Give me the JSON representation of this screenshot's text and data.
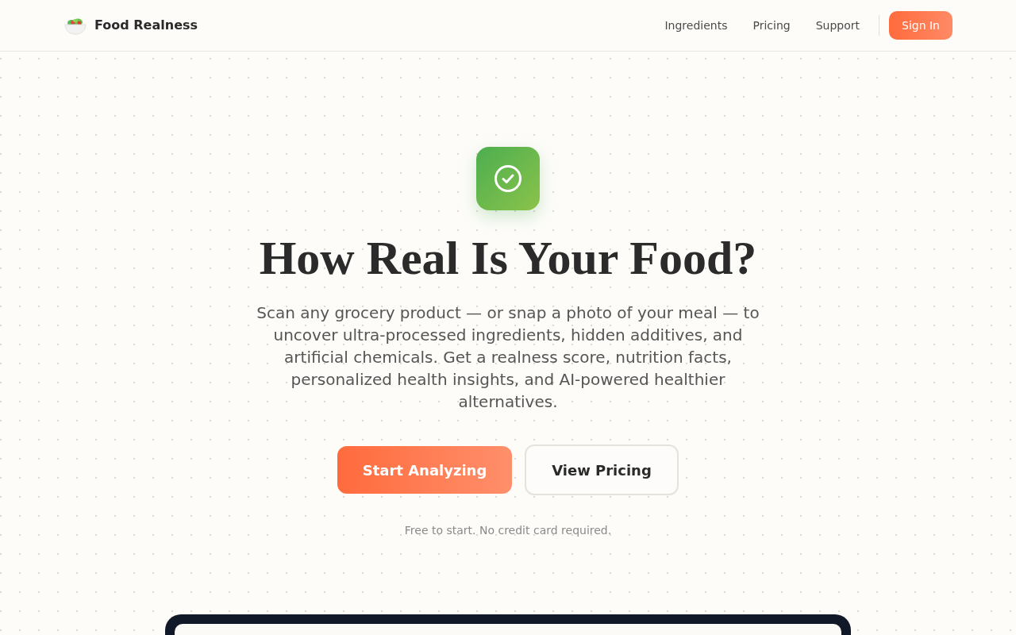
{
  "header": {
    "brand": "Food Realness",
    "links": [
      "Ingredients",
      "Pricing",
      "Support"
    ],
    "sign_in": "Sign In"
  },
  "hero": {
    "title": "How Real Is Your Food?",
    "description": "Scan any grocery product — or snap a photo of your meal — to uncover ultra-processed ingredients, hidden additives, and artificial chemicals. Get a realness score, nutrition facts, personalized health insights, and AI-powered healthier alternatives.",
    "buttons": [
      {
        "label": "Start Analyzing",
        "kind": "primary"
      },
      {
        "label": "View Pricing",
        "kind": "secondary"
      }
    ],
    "note": "Free to start. No credit card required."
  }
}
